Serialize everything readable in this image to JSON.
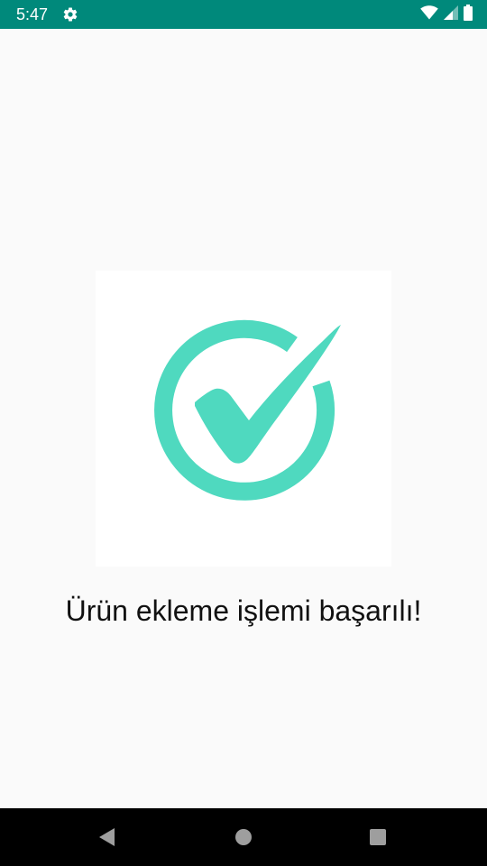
{
  "status_bar": {
    "time": "5:47",
    "background_color": "#00897b",
    "icons": [
      "settings-gear-icon",
      "wifi-icon",
      "cell-signal-icon",
      "battery-icon"
    ]
  },
  "content": {
    "image_icon": "success-check-circle-icon",
    "accent_color": "#4fd9bf",
    "message": "Ürün ekleme işlemi başarılı!"
  },
  "nav_bar": {
    "buttons": [
      "back-icon",
      "home-icon",
      "recents-icon"
    ],
    "button_color": "#9e9e9e"
  }
}
